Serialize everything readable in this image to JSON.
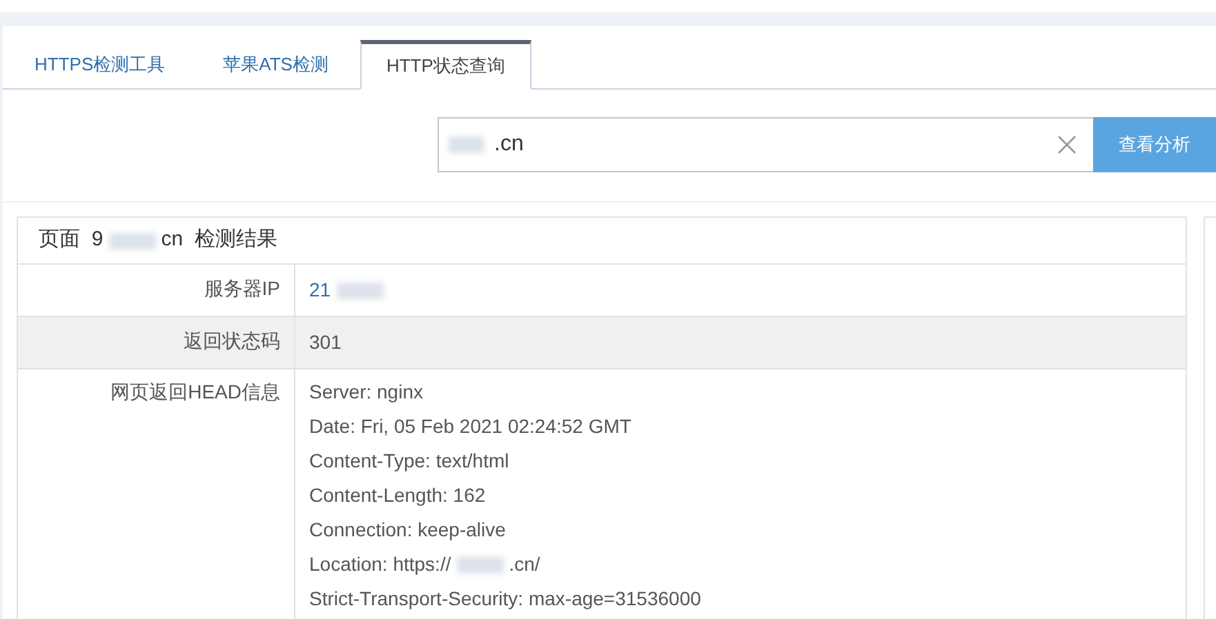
{
  "tabs": [
    {
      "label": "HTTPS检测工具",
      "selected": false
    },
    {
      "label": "苹果ATS检测",
      "selected": false
    },
    {
      "label": "HTTP状态查询",
      "selected": true
    }
  ],
  "search": {
    "value": ".cn",
    "button": "查看分析"
  },
  "result": {
    "title_parts": [
      "页面  9",
      "cn  检测结果"
    ],
    "rows": [
      {
        "label": "服务器IP",
        "kind": "link",
        "shaded": false,
        "lines": [
          {
            "parts": [
              "21"
            ]
          }
        ]
      },
      {
        "label": "返回状态码",
        "kind": "text",
        "shaded": true,
        "lines": [
          {
            "parts": [
              "301"
            ]
          }
        ]
      },
      {
        "label": "网页返回HEAD信息",
        "kind": "text",
        "shaded": false,
        "lines": [
          {
            "parts": [
              "Server: nginx"
            ]
          },
          {
            "parts": [
              "Date: Fri, 05 Feb 2021 02:24:52 GMT"
            ]
          },
          {
            "parts": [
              "Content-Type: text/html"
            ]
          },
          {
            "parts": [
              "Content-Length: 162"
            ]
          },
          {
            "parts": [
              "Connection: keep-alive"
            ]
          },
          {
            "parts": [
              "Location: https://",
              ".cn/"
            ]
          },
          {
            "parts": [
              "Strict-Transport-Security: max-age=31536000"
            ]
          }
        ]
      }
    ]
  }
}
